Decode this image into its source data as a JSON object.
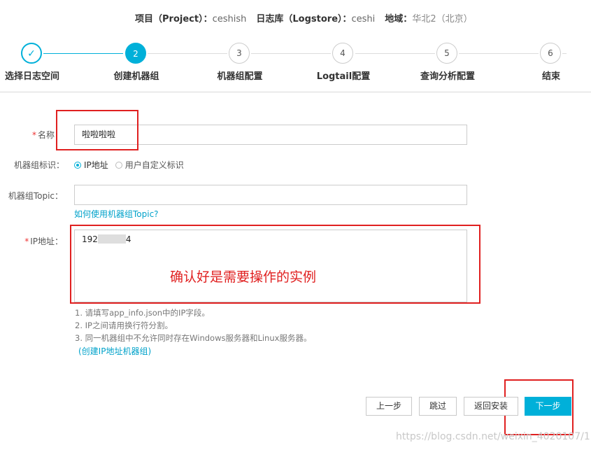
{
  "header": {
    "project_key": "项目（Project）：",
    "project_value": "ceshish",
    "logstore_key": "日志库（Logstore）：",
    "logstore_value": "ceshi",
    "region_key": "地域：",
    "region_value": "华北2（北京）"
  },
  "steps": [
    {
      "num": "✓",
      "label": "选择日志空间",
      "state": "done"
    },
    {
      "num": "2",
      "label": "创建机器组",
      "state": "active"
    },
    {
      "num": "3",
      "label": "机器组配置",
      "state": "todo"
    },
    {
      "num": "4",
      "label": "Logtail配置",
      "state": "todo"
    },
    {
      "num": "5",
      "label": "查询分析配置",
      "state": "todo"
    },
    {
      "num": "6",
      "label": "结束",
      "state": "todo"
    }
  ],
  "form": {
    "name_required": "*",
    "name_label": "名称：",
    "name_value": "啦啦啦啦",
    "identity_label": "机器组标识：",
    "identity_options": [
      "IP地址",
      "用户自定义标识"
    ],
    "identity_selected": "IP地址",
    "topic_label": "机器组Topic：",
    "topic_value": "",
    "topic_help_link": "如何使用机器组Topic?",
    "ip_required": "*",
    "ip_label": "IP地址：",
    "ip_value_prefix": "192",
    "ip_value_suffix": "4",
    "hints": [
      "1. 请填写app_info.json中的IP字段。",
      "2. IP之间请用换行符分割。",
      "3. 同一机器组中不允许同时存在Windows服务器和Linux服务器。"
    ],
    "create_link": "(创建IP地址机器组)"
  },
  "annotation": {
    "text": "确认好是需要操作的实例",
    "color": "#e02020"
  },
  "buttons": {
    "prev": "上一步",
    "skip": "跳过",
    "back": "返回安装",
    "next": "下一步"
  },
  "watermark": "https://blog.csdn.net/weixin_4020107/1",
  "colors": {
    "accent": "#00b0d9",
    "annotation": "#e02020"
  }
}
